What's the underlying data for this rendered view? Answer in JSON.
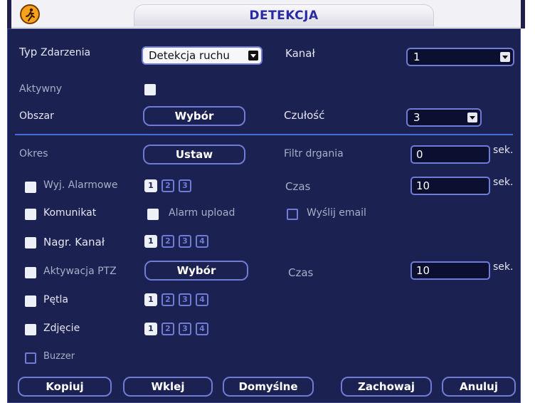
{
  "window": {
    "title": "DETEKCJA"
  },
  "form": {
    "event_type_label": "Typ",
    "event_type_label2": "Zdarzenia",
    "event_type_value": "Detekcja ruchu",
    "channel_label": "Kanał",
    "channel_value": "1",
    "active_label": "Aktywny",
    "area_label": "Obszar",
    "area_button": "Wybór",
    "sensitivity_label": "Czułość",
    "sensitivity_value": "3",
    "period_label": "Okres",
    "period_button": "Ustaw",
    "debounce_label": "Filtr drgania",
    "debounce_value": "0",
    "debounce_unit": "sek.",
    "alarm_out_label": "Wyj. Alarmowe",
    "alarm_out_channels": [
      "1",
      "2",
      "3"
    ],
    "time_label": "Czas",
    "time_value": "10",
    "time_unit": "sek.",
    "message_label": "Komunikat",
    "alarm_upload_label": "Alarm upload",
    "send_email_label": "Wyślij email",
    "record_channel_label": "Nagr. Kanał",
    "record_channels": [
      "1",
      "2",
      "3",
      "4"
    ],
    "ptz_label": "Aktywacja PTZ",
    "ptz_button": "Wybór",
    "ptz_time_label": "Czas",
    "ptz_time_value": "10",
    "ptz_time_unit": "sek.",
    "tour_label": "Pętla",
    "tour_channels": [
      "1",
      "2",
      "3",
      "4"
    ],
    "snapshot_label": "Zdjęcie",
    "snapshot_channels": [
      "1",
      "2",
      "3",
      "4"
    ],
    "buzzer_label": "Buzzer"
  },
  "buttons": {
    "copy": "Kopiuj",
    "paste": "Wklej",
    "default": "Domyślne",
    "save": "Zachowaj",
    "cancel": "Anuluj"
  },
  "colors": {
    "panel_bg": "#1b2150",
    "border_blue": "#6f7bd6",
    "title_text": "#2a2aa6"
  },
  "icons": {
    "logo": "running-man-icon"
  }
}
